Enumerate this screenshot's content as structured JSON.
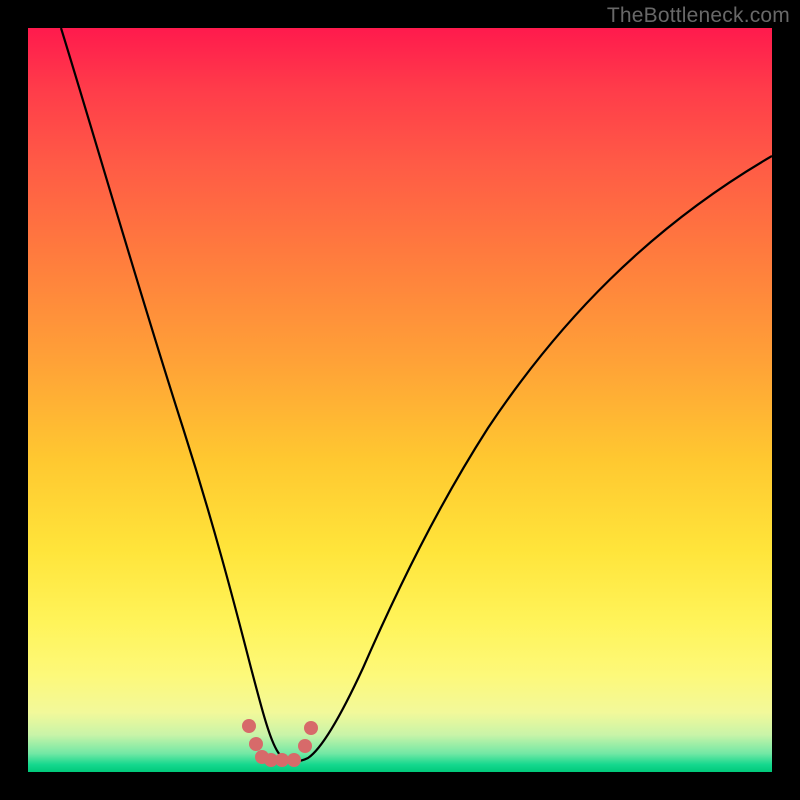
{
  "watermark": "TheBottleneck.com",
  "chart_data": {
    "type": "line",
    "title": "",
    "xlabel": "",
    "ylabel": "",
    "x": [
      0.0,
      0.05,
      0.1,
      0.15,
      0.2,
      0.23,
      0.26,
      0.29,
      0.31,
      0.34,
      0.37,
      0.4,
      0.45,
      0.5,
      0.55,
      0.6,
      0.68,
      0.76,
      0.85,
      0.93,
      1.0
    ],
    "y_pct_from_top": [
      0,
      17,
      32,
      47,
      62,
      72,
      82,
      90,
      95,
      98.5,
      98.5,
      95,
      86,
      75,
      65,
      57,
      46,
      37,
      29,
      23,
      18
    ],
    "markers": {
      "x": [
        0.297,
        0.307,
        0.314,
        0.327,
        0.342,
        0.358,
        0.373,
        0.381
      ],
      "y_pct_from_top": [
        93.8,
        96.3,
        98.0,
        98.4,
        98.4,
        98.4,
        96.5,
        94.1
      ]
    },
    "ylim": [
      0,
      100
    ],
    "xlim": [
      0,
      1
    ],
    "gradient_stops": [
      {
        "pos": 0,
        "color": "#ff1a4d"
      },
      {
        "pos": 0.45,
        "color": "#ffa237"
      },
      {
        "pos": 0.8,
        "color": "#fff45a"
      },
      {
        "pos": 0.97,
        "color": "#73e8a5"
      },
      {
        "pos": 1.0,
        "color": "#00c97a"
      }
    ]
  }
}
